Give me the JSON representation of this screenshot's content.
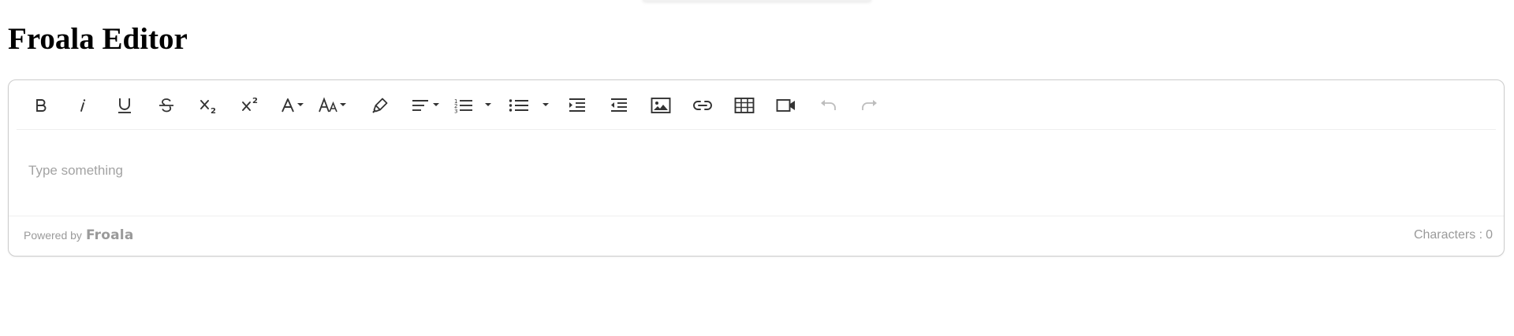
{
  "page": {
    "title": "Froala Editor"
  },
  "toolbar": {
    "buttons": [
      {
        "name": "bold",
        "icon": "bold-icon"
      },
      {
        "name": "italic",
        "icon": "italic-icon"
      },
      {
        "name": "underline",
        "icon": "underline-icon"
      },
      {
        "name": "strikethrough",
        "icon": "strikethrough-icon"
      },
      {
        "name": "subscript",
        "icon": "subscript-icon"
      },
      {
        "name": "superscript",
        "icon": "superscript-icon"
      },
      {
        "name": "text-color",
        "icon": "text-color-icon",
        "dropdown": true
      },
      {
        "name": "font-size",
        "icon": "font-size-icon",
        "dropdown": true
      },
      {
        "name": "highlight",
        "icon": "highlighter-icon"
      },
      {
        "name": "align",
        "icon": "align-left-icon",
        "dropdown": true
      },
      {
        "name": "ordered-list",
        "icon": "ordered-list-icon",
        "dropdown": true
      },
      {
        "name": "unordered-list",
        "icon": "unordered-list-icon",
        "dropdown": true
      },
      {
        "name": "indent",
        "icon": "indent-icon"
      },
      {
        "name": "outdent",
        "icon": "outdent-icon"
      },
      {
        "name": "insert-image",
        "icon": "image-icon"
      },
      {
        "name": "insert-link",
        "icon": "link-icon"
      },
      {
        "name": "insert-table",
        "icon": "table-icon"
      },
      {
        "name": "insert-video",
        "icon": "video-icon"
      },
      {
        "name": "undo",
        "icon": "undo-icon",
        "disabled": true
      },
      {
        "name": "redo",
        "icon": "redo-icon",
        "disabled": true
      }
    ]
  },
  "editor": {
    "placeholder": "Type something"
  },
  "footer": {
    "powered_by": "Powered by",
    "brand": "Froala",
    "characters_label": "Characters :",
    "characters_count": "0"
  },
  "colors": {
    "icon": "#333333",
    "icon_disabled": "#bdbdbd",
    "border": "#cccccc",
    "muted_text": "#9a9a9a"
  }
}
